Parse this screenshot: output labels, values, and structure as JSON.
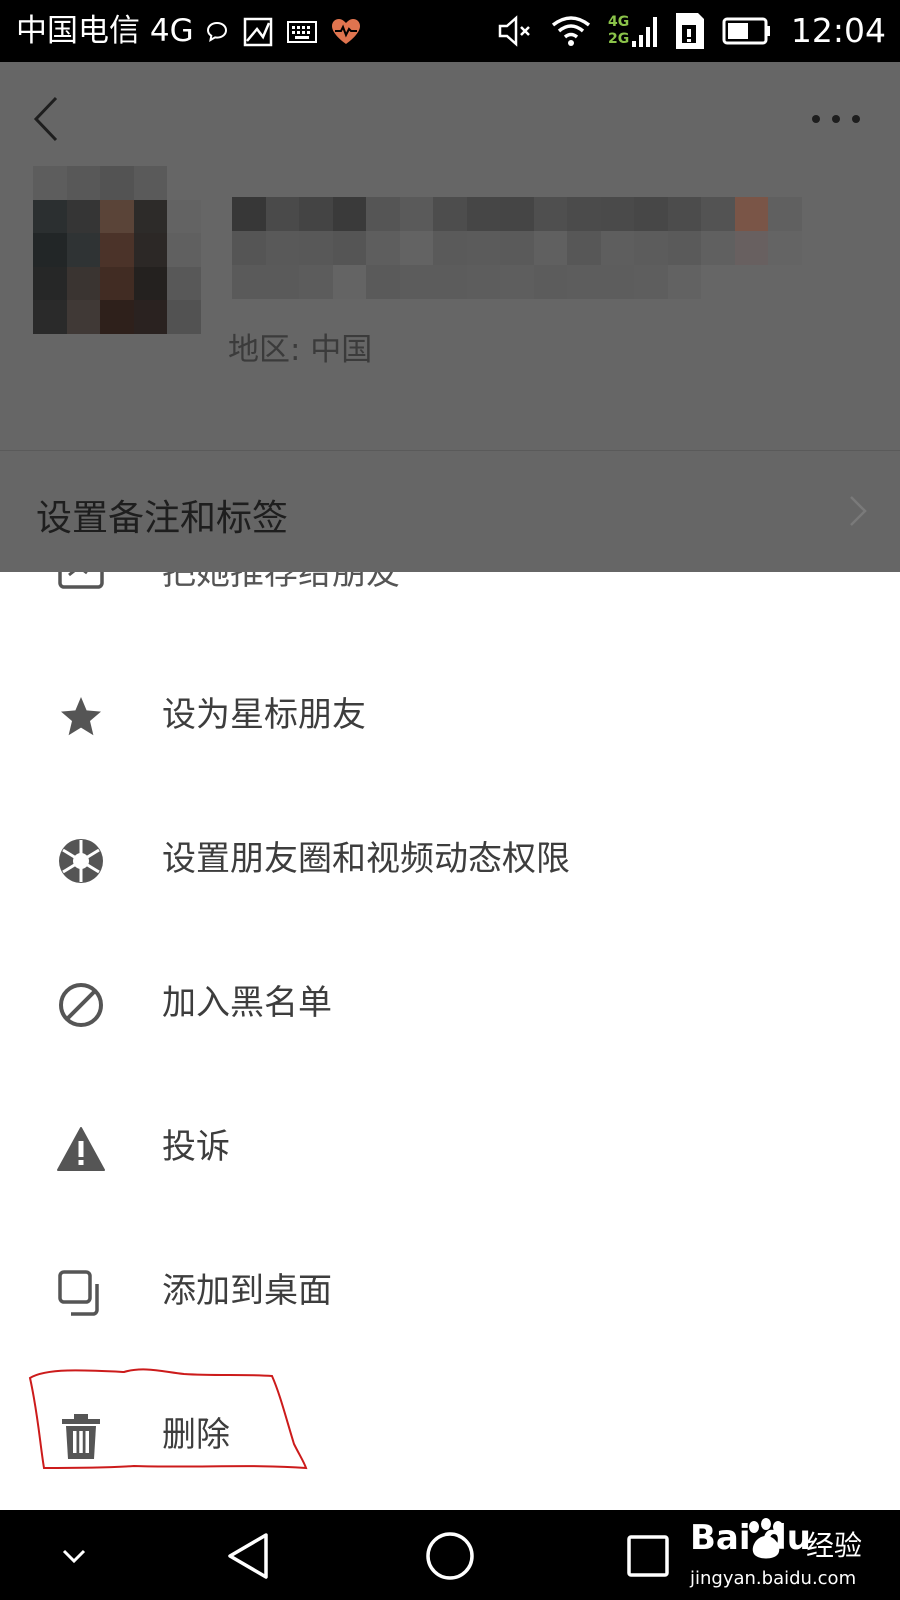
{
  "status_bar": {
    "carrier": "中国电信 4G",
    "net_top": "4G",
    "net_bottom": "2G",
    "time": "12:04",
    "icons": [
      "chat-bubble-icon",
      "image-icon",
      "keyboard-icon",
      "heart-rate-icon",
      "mute-icon",
      "wifi-icon",
      "signal-icon",
      "sim-icon",
      "battery-icon"
    ]
  },
  "profile": {
    "region": "地区: 中国",
    "remark_row_label": "设置备注和标签",
    "overlay_color": "#666666"
  },
  "menu": {
    "items": [
      {
        "label": "把她推荐给朋友",
        "icon": "share-card-icon"
      },
      {
        "label": "设为星标朋友",
        "icon": "star-icon"
      },
      {
        "label": "设置朋友圈和视频动态权限",
        "icon": "aperture-icon"
      },
      {
        "label": "加入黑名单",
        "icon": "block-icon"
      },
      {
        "label": "投诉",
        "icon": "warning-icon"
      },
      {
        "label": "添加到桌面",
        "icon": "add-to-desktop-icon"
      },
      {
        "label": "删除",
        "icon": "trash-icon"
      }
    ],
    "highlighted_item": "删除",
    "annotation_color": "#cc1b1b"
  },
  "nav_bar": {
    "buttons": [
      "hide-keyboard-icon",
      "back-triangle-icon",
      "home-circle-icon",
      "recents-square-icon"
    ]
  },
  "watermark": {
    "brand": "Bai  du",
    "product": "经验",
    "url": "jingyan.baidu.com"
  }
}
